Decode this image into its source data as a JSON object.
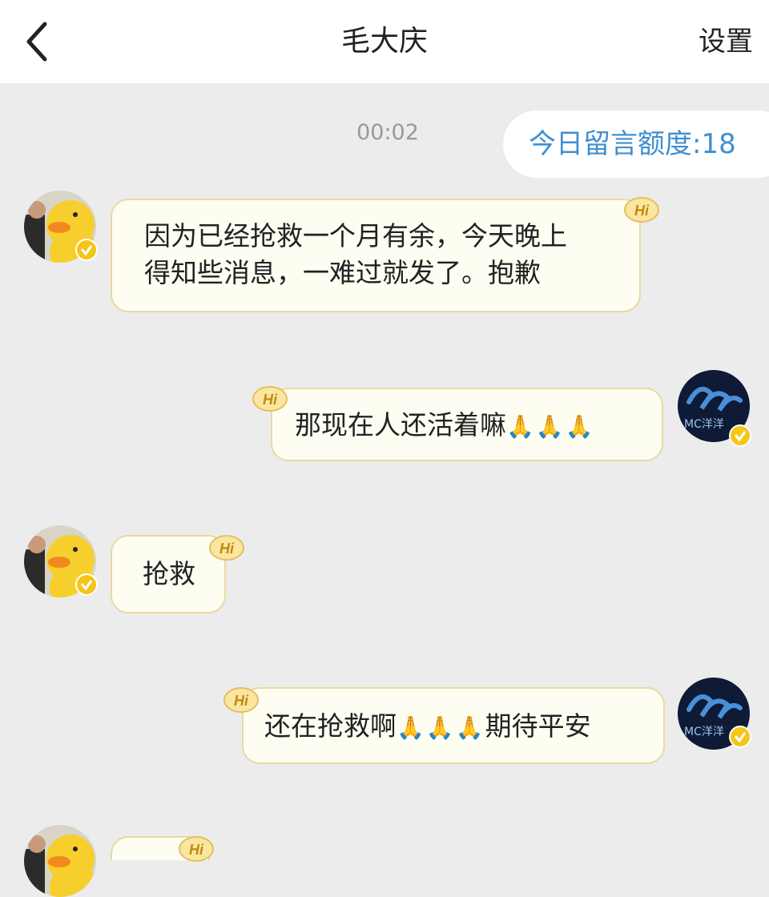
{
  "header": {
    "title": "毛大庆",
    "settings_label": "设置"
  },
  "chat": {
    "timestamp": "00:02",
    "quota_label": "今日留言额度:18",
    "hi_badge_text": "Hi",
    "avatar_right_text": "MC洋洋"
  },
  "messages": [
    {
      "sender": "contact",
      "line1": "因为已经抢救一个月有余，今天晚上",
      "line2": "得知些消息，一难过就发了。抱歉"
    },
    {
      "sender": "me",
      "text": "那现在人还活着嘛",
      "emoji": "🙏🙏🙏"
    },
    {
      "sender": "contact",
      "text": "抢救"
    },
    {
      "sender": "me",
      "text_before": "还在抢救啊",
      "emoji": "🙏🙏🙏",
      "text_after": "期待平安"
    },
    {
      "sender": "contact",
      "text": ""
    }
  ],
  "colors": {
    "quota_text": "#3f8fd1",
    "bubble_bg": "#fefdf2",
    "bubble_border": "#e9d9a2",
    "background": "#ececec"
  }
}
